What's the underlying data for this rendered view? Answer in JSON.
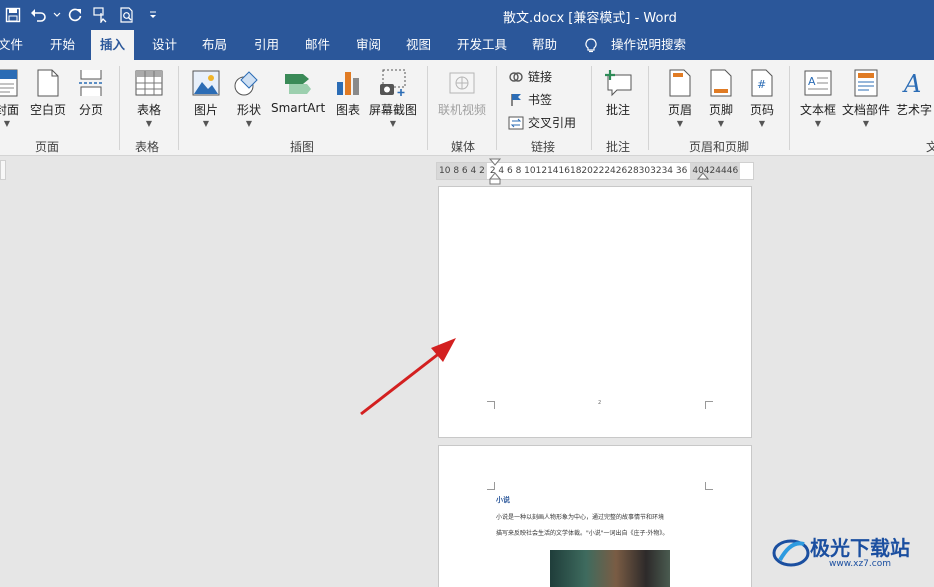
{
  "window": {
    "title": "散文.docx [兼容模式]  -  Word"
  },
  "quick_access": {
    "icons": [
      "save-icon",
      "undo-icon",
      "redo-icon",
      "touch-mode-icon",
      "print-preview-icon",
      "customize-icon"
    ]
  },
  "tabs": [
    "文件",
    "开始",
    "插入",
    "设计",
    "布局",
    "引用",
    "邮件",
    "审阅",
    "视图",
    "开发工具",
    "帮助",
    "操作说明搜索"
  ],
  "active_tab": "插入",
  "ribbon": {
    "pages": {
      "cover": "封面",
      "blank": "空白页",
      "break": "分页",
      "label": "页面"
    },
    "tables": {
      "table": "表格",
      "label": "表格"
    },
    "illustrations": {
      "picture": "图片",
      "shapes": "形状",
      "smartart": "SmartArt",
      "chart": "图表",
      "screenshot": "屏幕截图",
      "label": "插图"
    },
    "media": {
      "video": "联机视频",
      "label": "媒体"
    },
    "links": {
      "link": "链接",
      "bookmark": "书签",
      "crossref": "交叉引用",
      "label": "链接"
    },
    "comments": {
      "comment": "批注",
      "label": "批注"
    },
    "header_footer": {
      "header": "页眉",
      "footer": "页脚",
      "page_number": "页码",
      "label": "页眉和页脚"
    },
    "text": {
      "textbox": "文本框",
      "quickparts": "文档部件",
      "wordart": "艺术字",
      "label": "文"
    }
  },
  "ruler": {
    "left": "10 8 6 4 2",
    "middle": "2 4 6 8 10121416182022242628303234 36",
    "right": "40424446"
  },
  "document": {
    "page1_mark": "2",
    "heading": "小说",
    "line1": "小说是一种以刻画人物形象为中心，通过完整的故事情节和环境",
    "line2": "描写来反映社会生活的文学体裁。\"小说\"一词出自《庄子·外物》。"
  },
  "watermark": {
    "text": "极光下载站",
    "url": "www.xz7.com"
  },
  "colors": {
    "accent": "#2b579a",
    "arrow": "#d32020"
  }
}
